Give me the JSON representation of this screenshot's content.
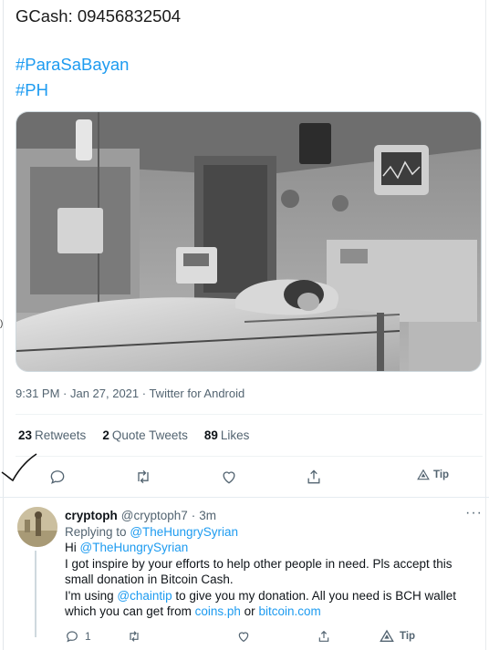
{
  "tweet": {
    "line1": "GCash: 09456832504",
    "hashtag1": "#ParaSaBayan",
    "hashtag2": "#PH",
    "timestamp": "9:31 PM · Jan 27, 2021 · Twitter for Android"
  },
  "stats": {
    "retweets_count": "23",
    "retweets_label": "Retweets",
    "quotes_count": "2",
    "quotes_label": "Quote Tweets",
    "likes_count": "89",
    "likes_label": "Likes"
  },
  "actions": {
    "tip_label": "Tip",
    "icons": [
      "reply-icon",
      "retweet-icon",
      "like-icon",
      "share-icon",
      "tip-icon"
    ]
  },
  "reply": {
    "name": "cryptoph",
    "handle": "@cryptoph7",
    "separator": "·",
    "time": "3m",
    "replying_prefix": "Replying to",
    "replying_to": "@TheHungrySyrian",
    "greeting": "Hi",
    "greeting_mention": "@TheHungrySyrian",
    "body1": "I got inspire by your efforts to help other people in need. Pls accept this small donation in Bitcoin Cash.",
    "body2_prefix": "I'm using",
    "body2_mention": "@chaintip",
    "body2_middle": "to give you my donation. All you need is BCH wallet which you can get from",
    "link1": "coins.ph",
    "link_joiner": "or",
    "link2": "bitcoin.com",
    "reply_count": "1",
    "tip_label": "Tip",
    "more_icon": "more-icon"
  },
  "colors": {
    "accent": "#1d9bf0",
    "muted": "#536471",
    "text": "#0f1419"
  }
}
